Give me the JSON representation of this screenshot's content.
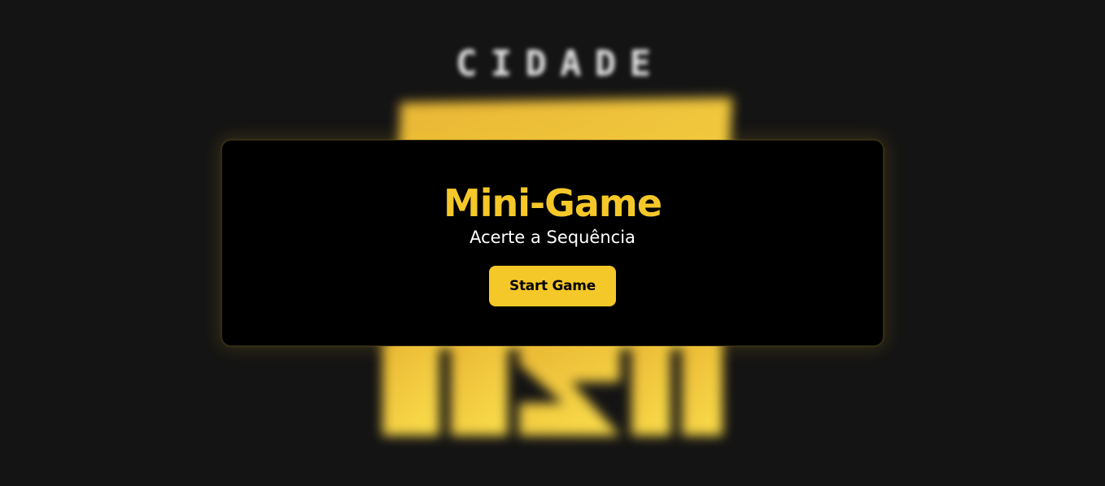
{
  "background": {
    "logo_word_letters": [
      "C",
      "I",
      "D",
      "A",
      "D",
      "E"
    ],
    "logo_icon": "city-logo-mark",
    "colors": {
      "page_bg": "#141414",
      "logo_gold_top": "#e9b634",
      "logo_gold_bottom": "#f8d948"
    }
  },
  "modal": {
    "title": "Mini-Game",
    "subtitle": "Acerte a Sequência",
    "start_button_label": "Start Game",
    "colors": {
      "accent": "#f5c829",
      "card_bg": "#000000",
      "subtitle": "#ffffff"
    }
  }
}
